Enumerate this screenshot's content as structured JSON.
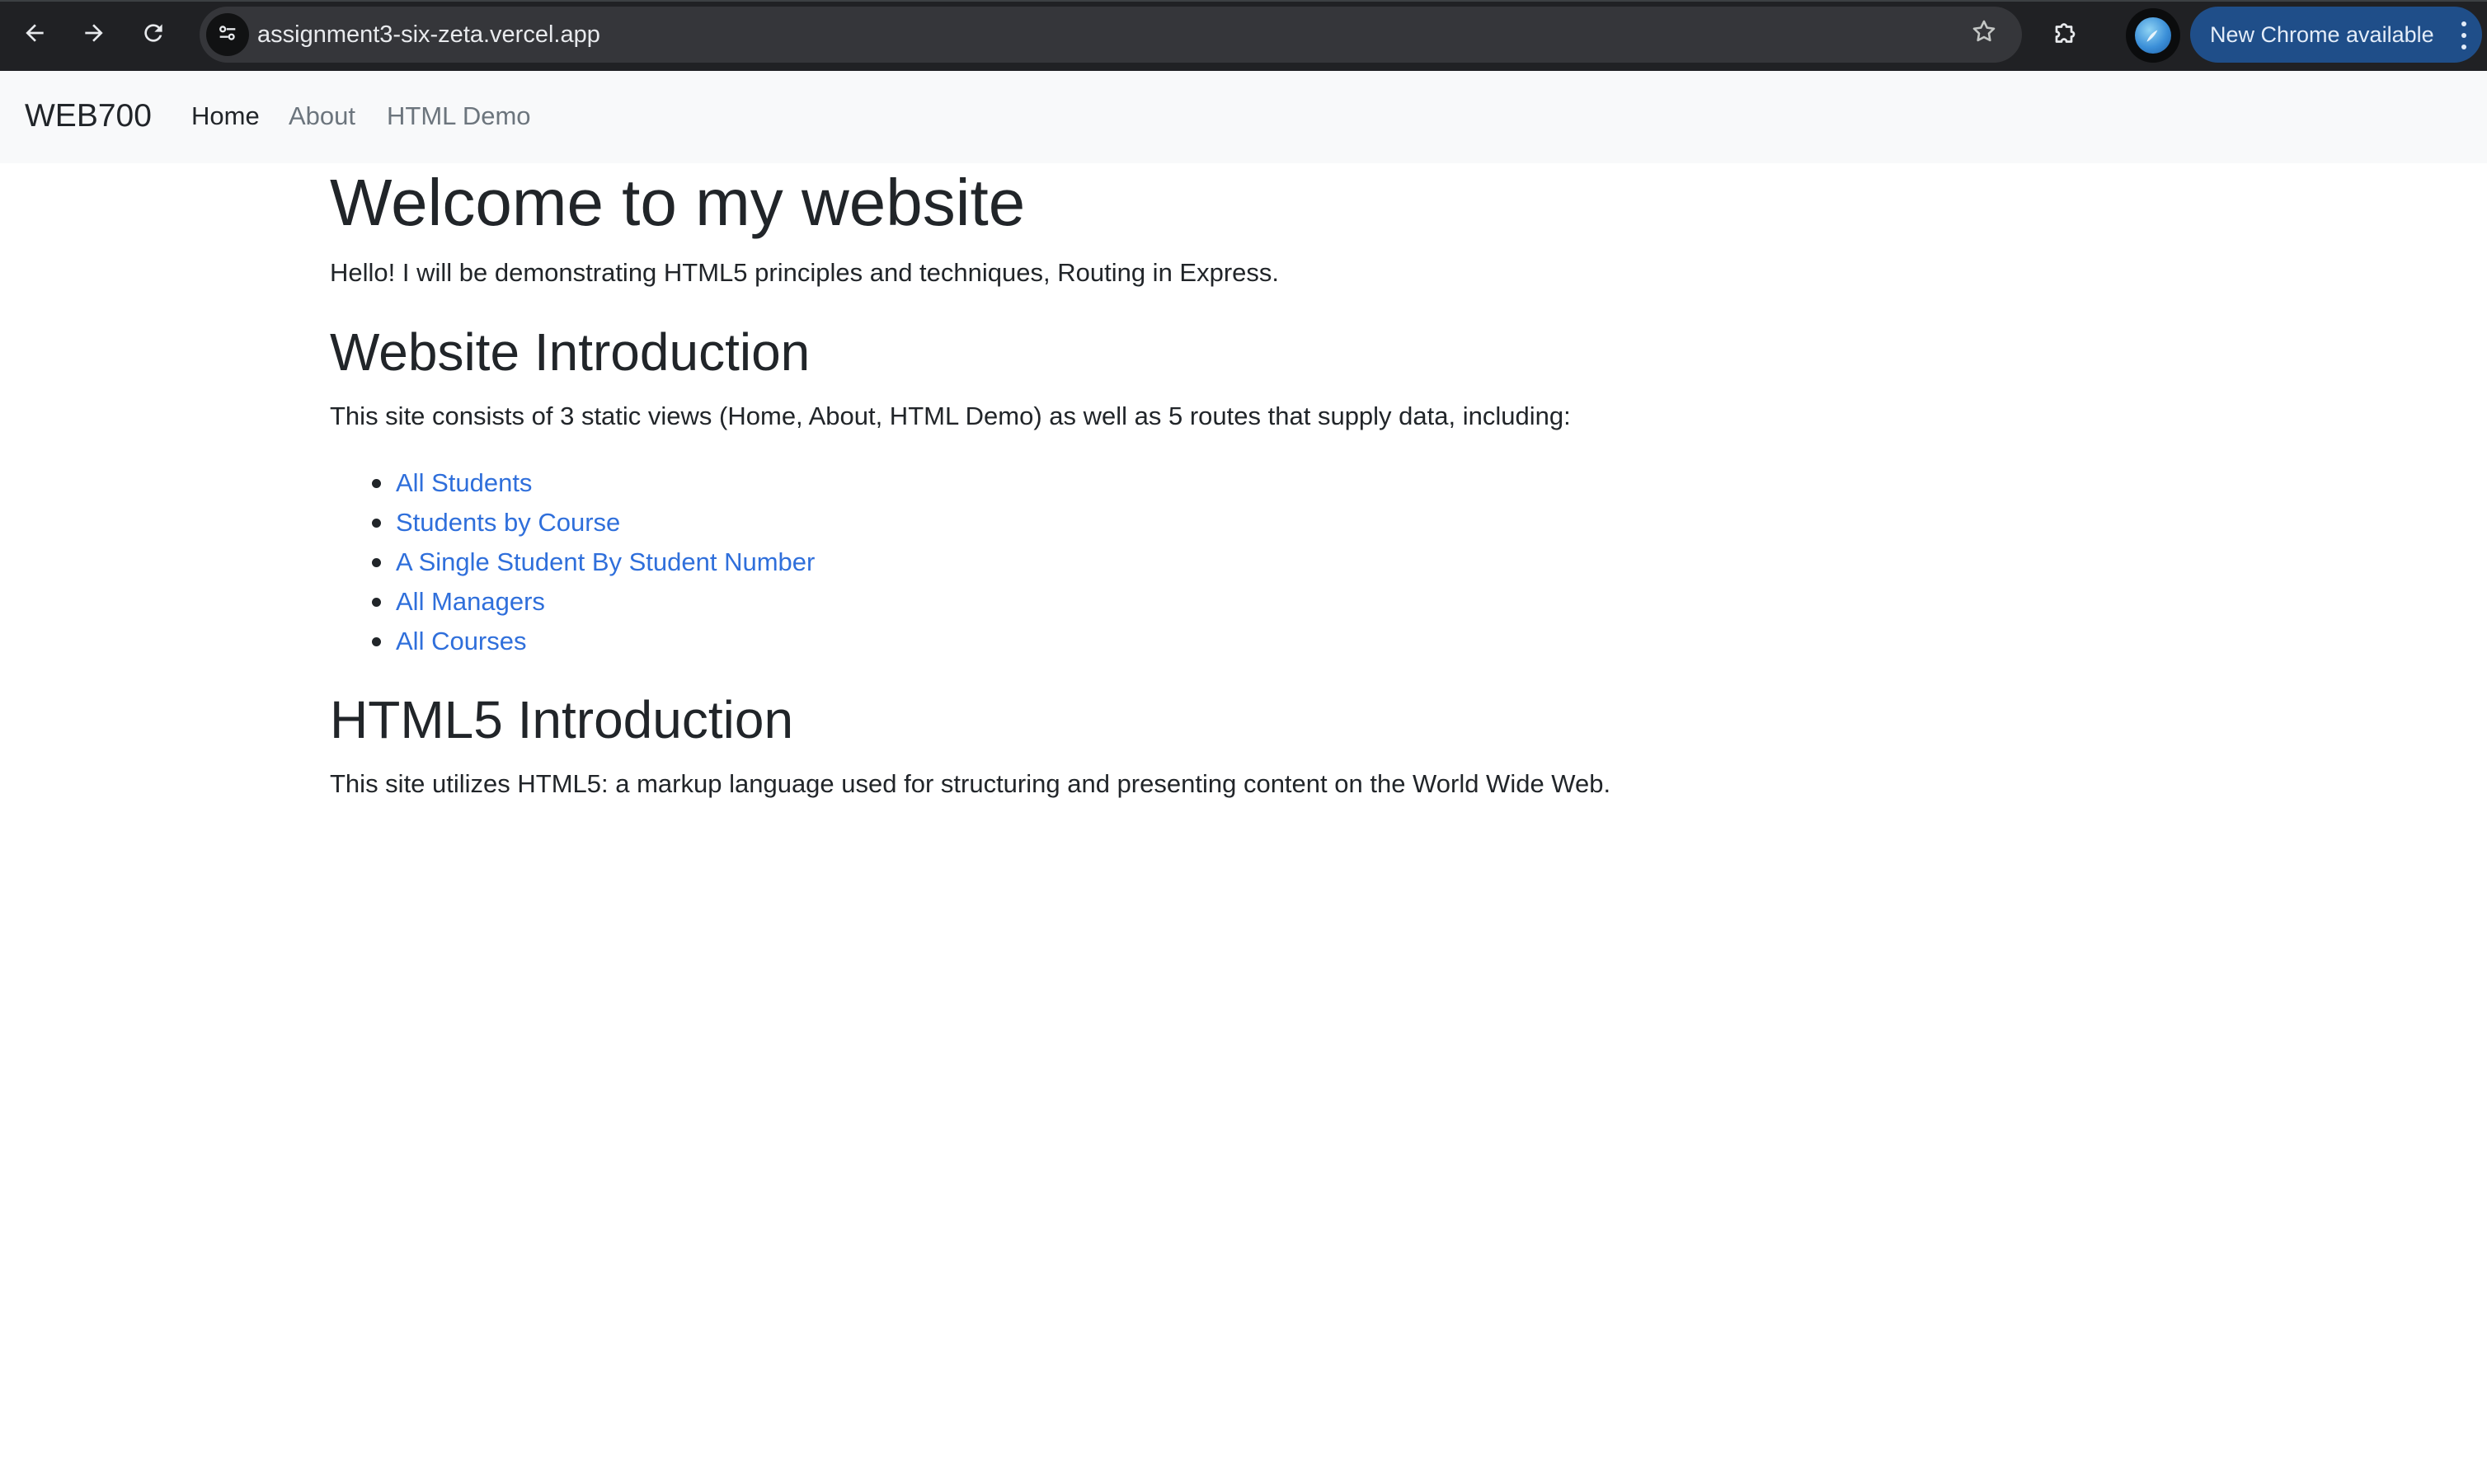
{
  "browser": {
    "url": "assignment3-six-zeta.vercel.app",
    "update_label": "New Chrome available",
    "icons": {
      "back": "back-arrow-icon",
      "forward": "forward-arrow-icon",
      "reload": "reload-icon",
      "site_info": "tune-icon",
      "bookmark": "star-icon",
      "extensions": "puzzle-icon",
      "profile": "avatar",
      "menu": "kebab-menu-icon"
    },
    "colors": {
      "toolbar_bg": "#202124",
      "omnibox_bg": "#35363a",
      "update_pill_bg": "#1f4e89"
    }
  },
  "navbar": {
    "brand": "WEB700",
    "links": [
      {
        "label": "Home",
        "active": true
      },
      {
        "label": "About",
        "active": false
      },
      {
        "label": "HTML Demo",
        "active": false
      }
    ],
    "colors": {
      "bg": "#f8f9fa",
      "active_text": "#212529",
      "inactive_text": "#6c757d"
    }
  },
  "main": {
    "title": "Welcome to my website",
    "intro": "Hello! I will be demonstrating HTML5 principles and techniques, Routing in Express.",
    "website_section": {
      "heading": "Website Introduction",
      "text": "This site consists of 3 static views (Home, About, HTML Demo) as well as 5 routes that supply data, including:",
      "routes": [
        "All Students",
        "Students by Course",
        "A Single Student By Student Number",
        "All Managers",
        "All Courses"
      ]
    },
    "html5_section": {
      "heading": "HTML5 Introduction",
      "text": "This site utilizes HTML5: a markup language used for structuring and presenting content on the World Wide Web."
    },
    "colors": {
      "text": "#212529",
      "link": "#2f6fdb"
    }
  }
}
